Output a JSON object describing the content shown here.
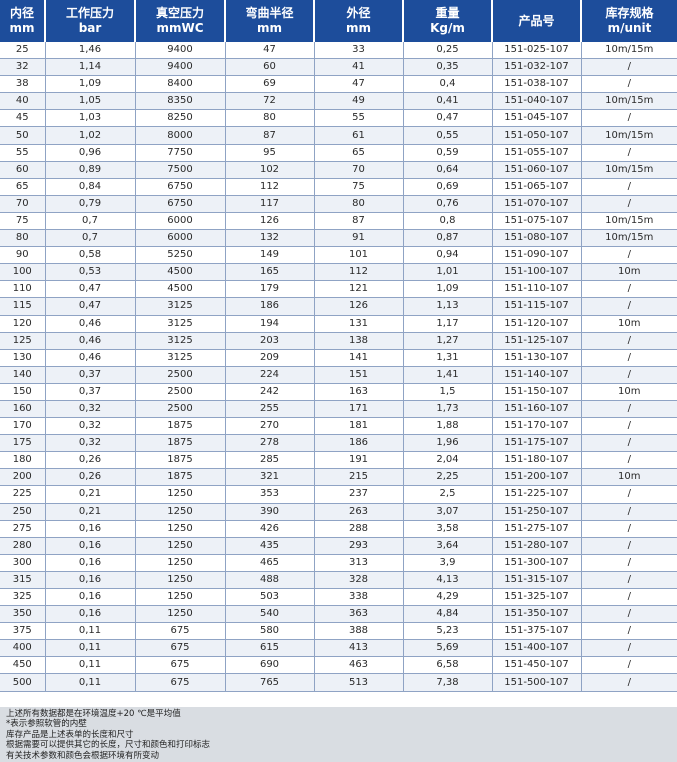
{
  "header": {
    "columns": [
      {
        "title": "内径",
        "unit": "mm"
      },
      {
        "title": "工作压力",
        "unit": "bar"
      },
      {
        "title": "真空压力",
        "unit": "mmWC"
      },
      {
        "title": "弯曲半径",
        "unit": "mm"
      },
      {
        "title": "外径",
        "unit": "mm"
      },
      {
        "title": "重量",
        "unit": "Kg/m"
      },
      {
        "title": "产品号",
        "unit": ""
      },
      {
        "title": "库存规格",
        "unit": "m/unit"
      }
    ]
  },
  "rows": [
    [
      "25",
      "1,46",
      "9400",
      "47",
      "33",
      "0,25",
      "151-025-107",
      "10m/15m"
    ],
    [
      "32",
      "1,14",
      "9400",
      "60",
      "41",
      "0,35",
      "151-032-107",
      "/"
    ],
    [
      "38",
      "1,09",
      "8400",
      "69",
      "47",
      "0,4",
      "151-038-107",
      "/"
    ],
    [
      "40",
      "1,05",
      "8350",
      "72",
      "49",
      "0,41",
      "151-040-107",
      "10m/15m"
    ],
    [
      "45",
      "1,03",
      "8250",
      "80",
      "55",
      "0,47",
      "151-045-107",
      "/"
    ],
    [
      "50",
      "1,02",
      "8000",
      "87",
      "61",
      "0,55",
      "151-050-107",
      "10m/15m"
    ],
    [
      "55",
      "0,96",
      "7750",
      "95",
      "65",
      "0,59",
      "151-055-107",
      "/"
    ],
    [
      "60",
      "0,89",
      "7500",
      "102",
      "70",
      "0,64",
      "151-060-107",
      "10m/15m"
    ],
    [
      "65",
      "0,84",
      "6750",
      "112",
      "75",
      "0,69",
      "151-065-107",
      "/"
    ],
    [
      "70",
      "0,79",
      "6750",
      "117",
      "80",
      "0,76",
      "151-070-107",
      "/"
    ],
    [
      "75",
      "0,7",
      "6000",
      "126",
      "87",
      "0,8",
      "151-075-107",
      "10m/15m"
    ],
    [
      "80",
      "0,7",
      "6000",
      "132",
      "91",
      "0,87",
      "151-080-107",
      "10m/15m"
    ],
    [
      "90",
      "0,58",
      "5250",
      "149",
      "101",
      "0,94",
      "151-090-107",
      "/"
    ],
    [
      "100",
      "0,53",
      "4500",
      "165",
      "112",
      "1,01",
      "151-100-107",
      "10m"
    ],
    [
      "110",
      "0,47",
      "4500",
      "179",
      "121",
      "1,09",
      "151-110-107",
      "/"
    ],
    [
      "115",
      "0,47",
      "3125",
      "186",
      "126",
      "1,13",
      "151-115-107",
      "/"
    ],
    [
      "120",
      "0,46",
      "3125",
      "194",
      "131",
      "1,17",
      "151-120-107",
      "10m"
    ],
    [
      "125",
      "0,46",
      "3125",
      "203",
      "138",
      "1,27",
      "151-125-107",
      "/"
    ],
    [
      "130",
      "0,46",
      "3125",
      "209",
      "141",
      "1,31",
      "151-130-107",
      "/"
    ],
    [
      "140",
      "0,37",
      "2500",
      "224",
      "151",
      "1,41",
      "151-140-107",
      "/"
    ],
    [
      "150",
      "0,37",
      "2500",
      "242",
      "163",
      "1,5",
      "151-150-107",
      "10m"
    ],
    [
      "160",
      "0,32",
      "2500",
      "255",
      "171",
      "1,73",
      "151-160-107",
      "/"
    ],
    [
      "170",
      "0,32",
      "1875",
      "270",
      "181",
      "1,88",
      "151-170-107",
      "/"
    ],
    [
      "175",
      "0,32",
      "1875",
      "278",
      "186",
      "1,96",
      "151-175-107",
      "/"
    ],
    [
      "180",
      "0,26",
      "1875",
      "285",
      "191",
      "2,04",
      "151-180-107",
      "/"
    ],
    [
      "200",
      "0,26",
      "1875",
      "321",
      "215",
      "2,25",
      "151-200-107",
      "10m"
    ],
    [
      "225",
      "0,21",
      "1250",
      "353",
      "237",
      "2,5",
      "151-225-107",
      "/"
    ],
    [
      "250",
      "0,21",
      "1250",
      "390",
      "263",
      "3,07",
      "151-250-107",
      "/"
    ],
    [
      "275",
      "0,16",
      "1250",
      "426",
      "288",
      "3,58",
      "151-275-107",
      "/"
    ],
    [
      "280",
      "0,16",
      "1250",
      "435",
      "293",
      "3,64",
      "151-280-107",
      "/"
    ],
    [
      "300",
      "0,16",
      "1250",
      "465",
      "313",
      "3,9",
      "151-300-107",
      "/"
    ],
    [
      "315",
      "0,16",
      "1250",
      "488",
      "328",
      "4,13",
      "151-315-107",
      "/"
    ],
    [
      "325",
      "0,16",
      "1250",
      "503",
      "338",
      "4,29",
      "151-325-107",
      "/"
    ],
    [
      "350",
      "0,16",
      "1250",
      "540",
      "363",
      "4,84",
      "151-350-107",
      "/"
    ],
    [
      "375",
      "0,11",
      "675",
      "580",
      "388",
      "5,23",
      "151-375-107",
      "/"
    ],
    [
      "400",
      "0,11",
      "675",
      "615",
      "413",
      "5,69",
      "151-400-107",
      "/"
    ],
    [
      "450",
      "0,11",
      "675",
      "690",
      "463",
      "6,58",
      "151-450-107",
      "/"
    ],
    [
      "500",
      "0,11",
      "675",
      "765",
      "513",
      "7,38",
      "151-500-107",
      "/"
    ]
  ],
  "notes": [
    "上述所有数据都是在环境温度+20 ℃是平均值",
    "*表示参照软管的内壁",
    "库存产品是上述表单的长度和尺寸",
    "根据需要可以提供其它的长度，尺寸和颜色和打印标志",
    "有关技术参数和颜色会根据环境有所变动"
  ]
}
